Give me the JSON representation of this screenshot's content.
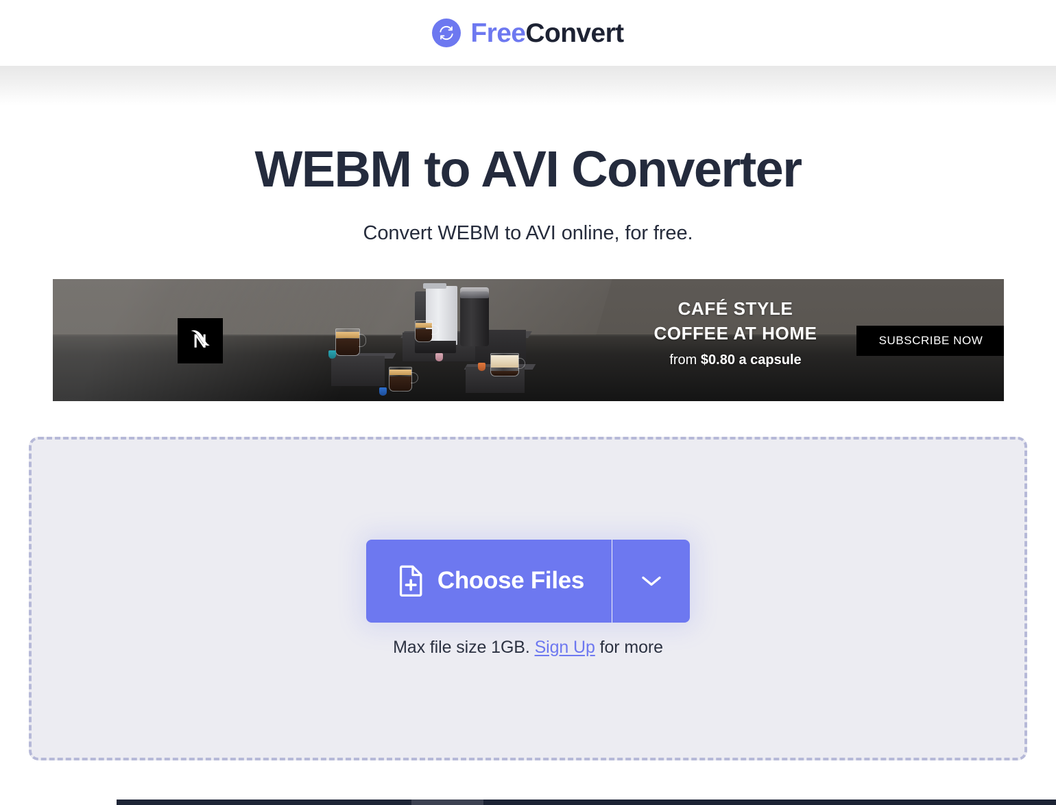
{
  "header": {
    "logo_icon": "sync-circle-icon",
    "brand_first": "Free",
    "brand_second": "Convert",
    "brand_color_primary": "#6d78f0",
    "brand_color_secondary": "#1d2233"
  },
  "hero": {
    "title": "WEBM to AVI Converter",
    "subtitle": "Convert WEBM to AVI online, for free."
  },
  "advertisement": {
    "brand": "Nespresso",
    "brand_logo_icon": "nespresso-n-icon",
    "headline_line1": "CAFÉ STYLE",
    "headline_line2": "COFFEE AT HOME",
    "price_prefix": "from ",
    "price_value": "$0.80 a capsule",
    "cta_label": "SUBSCRIBE NOW",
    "cta_background": "#000000",
    "text_color": "#ffffff"
  },
  "dropzone": {
    "choose_files_label": "Choose Files",
    "choose_files_icon": "file-plus-icon",
    "caret_icon": "chevron-down-icon",
    "note_prefix": "Max file size 1GB. ",
    "note_link": "Sign Up",
    "note_suffix": " for more",
    "accent_color": "#6d78f0",
    "border_color": "#b6b9d8",
    "background_color": "#ececf2"
  },
  "footer": {
    "strip_color_dark": "#1e2536",
    "strip_color_mid": "#3d4252"
  }
}
